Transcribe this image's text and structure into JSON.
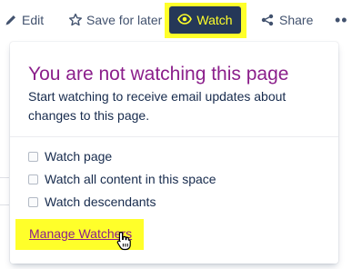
{
  "toolbar": {
    "edit_label": "Edit",
    "save_label": "Save for later",
    "watch_label": "Watch",
    "share_label": "Share",
    "more_label": "••"
  },
  "popup": {
    "title": "You are not watching this page",
    "description": "Start watching to receive email updates about changes to this page.",
    "options": [
      {
        "label": "Watch page",
        "checked": false
      },
      {
        "label": "Watch all content in this space",
        "checked": false
      },
      {
        "label": "Watch descendants",
        "checked": false
      }
    ],
    "manage_link": "Manage Watchers"
  },
  "colors": {
    "highlight": "#ffff2a",
    "watch_button_bg": "#253858",
    "accent_purple": "#8b1f8b",
    "toolbar_text": "#42526e"
  },
  "icons": {
    "edit": "pencil-icon",
    "save": "star-icon",
    "watch": "eye-icon",
    "share": "share-icon",
    "cursor": "hand-pointer-cursor"
  }
}
